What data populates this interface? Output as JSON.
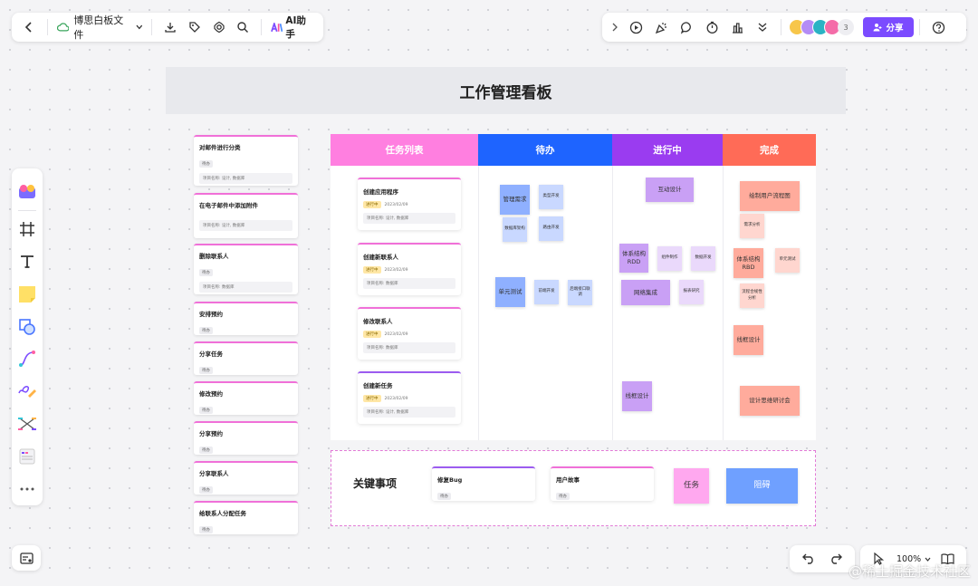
{
  "topbar": {
    "file_name": "博思白板文件",
    "ai_label": "AI助手",
    "collaborator_count": "3",
    "share_label": "分享"
  },
  "board": {
    "title": "工作管理看板",
    "columns": [
      {
        "label": "任务列表",
        "color": "#ff7fe0"
      },
      {
        "label": "待办",
        "color": "#1e64ff"
      },
      {
        "label": "进行中",
        "color": "#9a3cf0"
      },
      {
        "label": "完成",
        "color": "#ff6b57"
      }
    ]
  },
  "left_cards": [
    {
      "title": "对邮件进行分类",
      "tag": "待办",
      "meta": "项目名称: 设计, 数据库"
    },
    {
      "title": "在电子邮件中添加附件",
      "tag": "",
      "meta": "项目名称: 设计, 数据库"
    },
    {
      "title": "删除联系人",
      "tag": "待办",
      "meta": "项目名称: 数据库"
    },
    {
      "title": "安排预约",
      "tag": "待办",
      "meta": ""
    },
    {
      "title": "分享任务",
      "tag": "待办",
      "meta": ""
    },
    {
      "title": "修改预约",
      "tag": "待办",
      "meta": ""
    },
    {
      "title": "分享预约",
      "tag": "待办",
      "meta": ""
    },
    {
      "title": "分享联系人",
      "tag": "待办",
      "meta": ""
    },
    {
      "title": "给联系人分配任务",
      "tag": "待办",
      "meta": ""
    }
  ],
  "task_cards": [
    {
      "title": "创建应用程序",
      "status": "进行中",
      "date": "2023/02/09",
      "meta": "项目名称: 设计, 数据库"
    },
    {
      "title": "创建新联系人",
      "status": "进行中",
      "date": "2023/02/09",
      "meta": "项目名称: 数据库"
    },
    {
      "title": "修改联系人",
      "status": "进行中",
      "date": "2023/02/09",
      "meta": "项目名称: 数据库"
    },
    {
      "title": "创建新任务",
      "status": "进行中",
      "date": "2023/02/09",
      "meta": "项目名称: 设计, 数据库"
    }
  ],
  "todo_notes": {
    "a": "管理需求",
    "b": "类型开发",
    "c": "数据库架构",
    "d": "路由开发",
    "e": "单元测试",
    "f": "前端开发",
    "g": "后端接口联调"
  },
  "progress_notes": {
    "a": "互动设计",
    "b": "体系结构RDD",
    "c": "组件制作",
    "d": "数据开发",
    "e": "网络集成",
    "f": "报表研究",
    "g": "线框设计"
  },
  "done_notes": {
    "a": "绘制用户流程图",
    "b": "需求分析",
    "c": "体系结构RBD",
    "d": "单元测试",
    "e": "流程合规性分析",
    "f": "线框设计",
    "g": "设计思维研讨会"
  },
  "key_items": {
    "label": "关键事项",
    "card1_title": "修复Bug",
    "card1_tag": "待办",
    "card2_title": "用户故事",
    "card2_tag": "待办",
    "note_task": "任务",
    "note_block": "阻碍"
  },
  "bottom": {
    "zoom": "100%",
    "watermark": "@稀土掘金技术社区"
  }
}
